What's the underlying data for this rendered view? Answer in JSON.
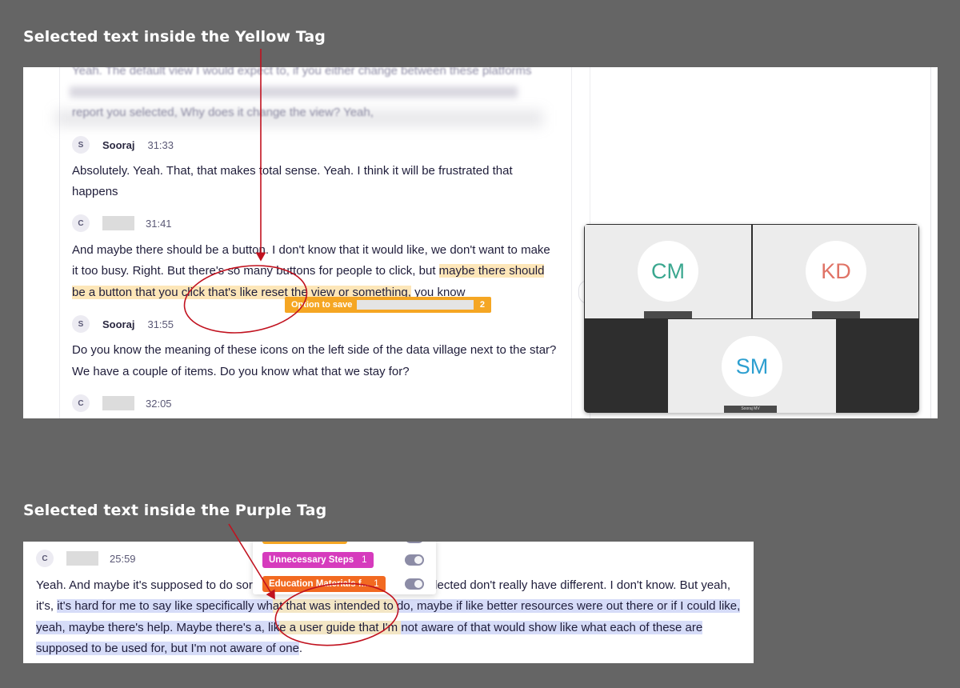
{
  "captions": {
    "top": "Selected text inside the Yellow Tag",
    "bottom": "Selected text inside the Purple Tag"
  },
  "top_panel": {
    "faded_lines": [
      "Yeah. The default view I would expect to, if you either change between these platforms",
      "report you selected, Why does it change the view? Yeah,"
    ],
    "entries": [
      {
        "avatar": "S",
        "speaker": "Sooraj",
        "time": "31:33",
        "lines": [
          "Absolutely. Yeah. That, that makes total sense. Yeah. I think it will be frustrated that",
          "happens"
        ]
      },
      {
        "avatar": "C",
        "speaker": "",
        "time": "31:41",
        "line1": "And maybe there should be a button. I don't know that it would like, we don't want to make",
        "line2_plain": "it too busy. Right. But there's so many buttons for people to click, but ",
        "line2_highlight": "maybe there should",
        "line3_highlight": "be a button that you click that's like reset the view or something,",
        "line3_plain": " you know"
      },
      {
        "avatar": "S",
        "speaker": "Sooraj",
        "time": "31:55",
        "lines": [
          "Do you know the meaning of these icons on the left side of the data village next to the star?",
          "We have a couple of items. Do you know what that we stay for?"
        ]
      },
      {
        "avatar": "C",
        "speaker": "",
        "time": "32:05"
      }
    ],
    "save_popup": {
      "label": "Option to save",
      "count": "2",
      "color": "#f5a623"
    },
    "video_tiles": [
      {
        "initials": "CM",
        "color": "#3aa78f"
      },
      {
        "initials": "KD",
        "color": "#e07366"
      },
      {
        "initials": "SM",
        "color": "#2d9fd0",
        "name": "Sooraj MV"
      }
    ]
  },
  "bottom_panel": {
    "entry": {
      "avatar": "C",
      "time": "25:59"
    },
    "line1_a": "Yeah. And maybe it's supposed to do sor",
    "line1_b": "elected don't really have different. I don't know. But yeah,",
    "line2_plain": "it's, ",
    "line2_hl1": "it's hard for me to say like specifically wh",
    "line2_hl2": "at that was intended to ",
    "line2_hl3": "do, maybe if like better resources were out there or if I could like,",
    "line3_hl1": "yeah, maybe there's help. Maybe there's a, lik",
    "line3_hl2": "e a user guide that I'm ",
    "line3_hl3": "not aware of that would show like what each of these are",
    "line4_hl": "supposed to be used for, but I'm not aware of one",
    "line4_plain": ".",
    "tags": [
      {
        "label": "Unnecessary Steps",
        "count": "1",
        "color": "#d63bbd"
      },
      {
        "label": "Education Materials f...",
        "count": "1",
        "color": "#f26a21"
      }
    ],
    "top_tag_color": "#f5a623"
  },
  "colors": {
    "annotation": "#c1121f",
    "yellow_highlight": "#fde6b8",
    "purple_highlight": "#d6dcf8"
  }
}
